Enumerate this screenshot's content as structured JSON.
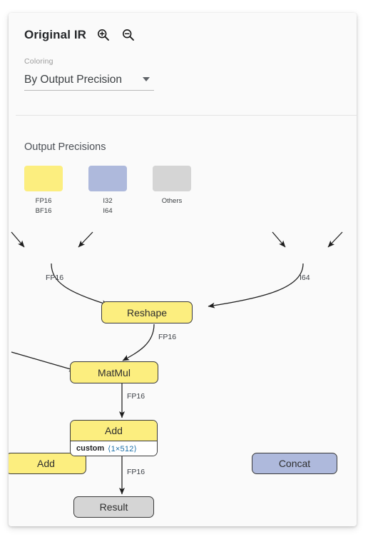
{
  "panel": {
    "title": "Original IR",
    "zoom_in_icon": "zoom-in-icon",
    "zoom_out_icon": "zoom-out-icon"
  },
  "coloring": {
    "label": "Coloring",
    "value": "By Output Precision",
    "caret_icon": "chevron-down-icon"
  },
  "legend": {
    "title": "Output Precisions",
    "items": [
      {
        "color": "#FCEE7F",
        "labels": [
          "FP16",
          "BF16"
        ]
      },
      {
        "color": "#AEB9DC",
        "labels": [
          "I32",
          "I64"
        ]
      },
      {
        "color": "#D5D5D5",
        "labels": [
          "Others"
        ]
      }
    ]
  },
  "graph": {
    "nodes": [
      {
        "id": "add_top",
        "label": "Add",
        "color": "#FCEE7F"
      },
      {
        "id": "concat",
        "label": "Concat",
        "color": "#AEB9DC"
      },
      {
        "id": "reshape",
        "label": "Reshape",
        "color": "#FCEE7F"
      },
      {
        "id": "matmul",
        "label": "MatMul",
        "color": "#FCEE7F"
      },
      {
        "id": "add_bias",
        "label": "Add",
        "color": "#FCEE7F",
        "attr_key": "custom",
        "attr_value": "⟨1×512⟩"
      },
      {
        "id": "result",
        "label": "Result",
        "color": "#D5D5D5"
      }
    ],
    "edge_labels": [
      {
        "id": "e1",
        "text": "FP16"
      },
      {
        "id": "e2",
        "text": "I64"
      },
      {
        "id": "e3",
        "text": "FP16"
      },
      {
        "id": "e4",
        "text": "FP16"
      },
      {
        "id": "e5",
        "text": "FP16"
      }
    ]
  }
}
